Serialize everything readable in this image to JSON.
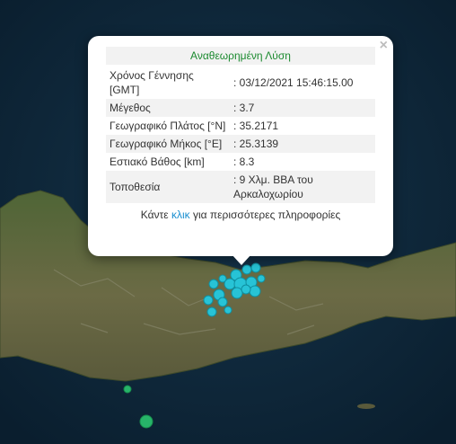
{
  "popup": {
    "title": "Αναθεωρημένη Λύση",
    "title_color": "#1b8a2f",
    "close_icon": "×",
    "rows": [
      {
        "label": "Χρόνος Γέννησης [GMT]",
        "value": ": 03/12/2021 15:46:15.00"
      },
      {
        "label": "Μέγεθος",
        "value": ": 3.7"
      },
      {
        "label": "Γεωγραφικό Πλάτος [°N]",
        "value": ": 35.2171"
      },
      {
        "label": "Γεωγραφικό Μήκος [°E]",
        "value": ": 25.3139"
      },
      {
        "label": "Εστιακό Βάθος [km]",
        "value": ": 8.3"
      },
      {
        "label": "Τοποθεσία",
        "value": ": 9 Χλμ. ΒΒΑ του Αρκαλοχωρίου"
      }
    ],
    "more": {
      "before": "Κάντε ",
      "link": "κλικ",
      "after": " για περισσότερες πληροφορίες"
    }
  },
  "map": {
    "sea_color": "#0c2436",
    "land_color": "#5c6b3e",
    "marker_color": "#27c3d6",
    "offshore_marker_color": "#27b469"
  }
}
